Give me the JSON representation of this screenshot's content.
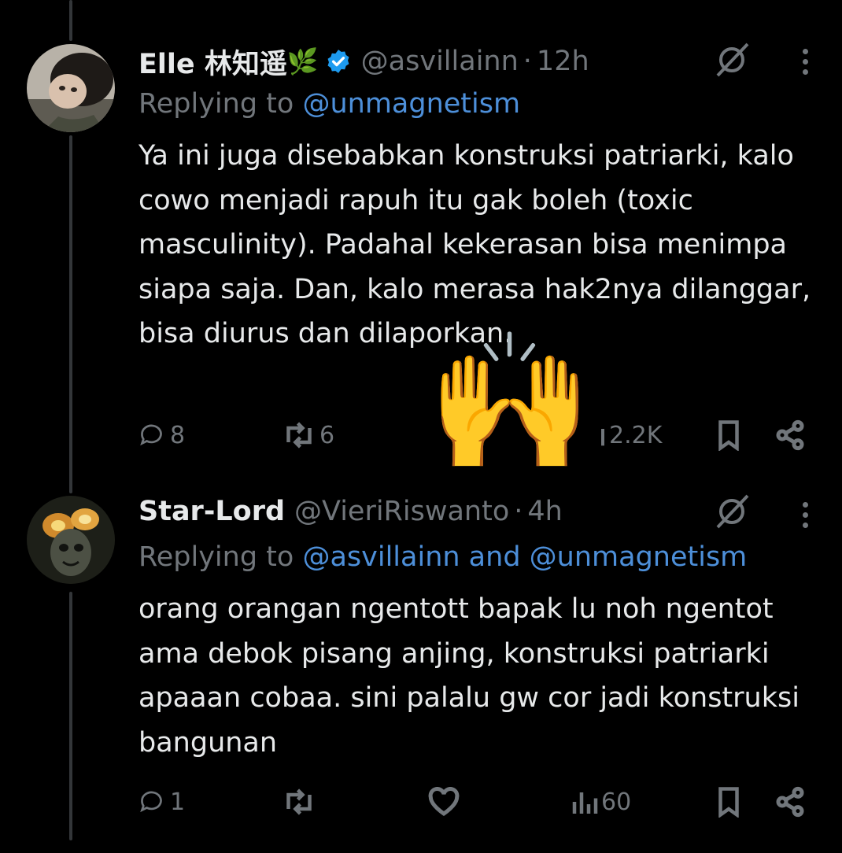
{
  "tweets": [
    {
      "name": "Elle 林知遥",
      "name_emoji": "🌿",
      "handle": "@asvillainn",
      "dot": "·",
      "time": "12h",
      "replying_prefix": "Replying to ",
      "replying_to": "@unmagnetism",
      "text": "Ya ini juga disebabkan konstruksi patriarki, kalo cowo menjadi rapuh itu gak boleh (toxic masculinity). Padahal kekerasan bisa menimpa siapa saja. Dan, kalo merasa hak2nya dilanggar, bisa diurus dan dilaporkan.",
      "replies": "8",
      "reposts": "6",
      "views": "2.2K"
    },
    {
      "name": "Star-Lord",
      "handle": "@VieriRiswanto",
      "dot": "·",
      "time": "4h",
      "replying_prefix": "Replying to ",
      "replying_to": "@asvillainn and @unmagnetism",
      "text": "orang orangan ngentott bapak lu noh ngentot ama debok pisang anjing, konstruksi patriarki apaaan cobaa. sini palalu gw cor jadi konstruksi bangunan",
      "replies": "1",
      "views": "60"
    }
  ],
  "overlay_emoji": "🙌",
  "colors": {
    "background": "#000000",
    "text": "#e7e9ea",
    "muted": "#71767b",
    "link": "#4d8fd9",
    "verified": "#1d9bf0"
  },
  "icons": [
    "reply-icon",
    "repost-icon",
    "like-icon",
    "views-icon",
    "bookmark-icon",
    "share-icon",
    "grok-icon",
    "more-icon",
    "verified-badge-icon"
  ]
}
